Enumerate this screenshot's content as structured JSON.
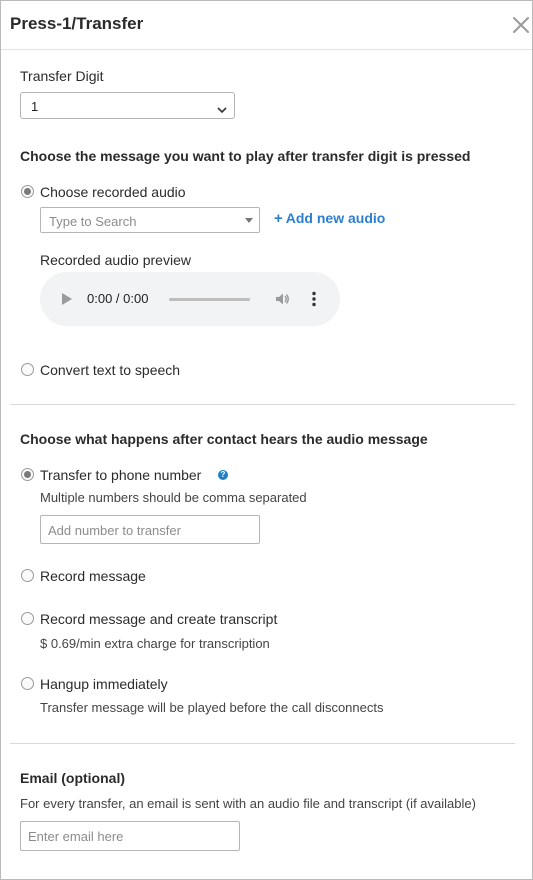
{
  "header": {
    "title": "Press-1/Transfer",
    "close_icon": "close-icon"
  },
  "transfer_digit": {
    "label": "Transfer Digit",
    "selected": "1"
  },
  "message_section": {
    "title": "Choose the message you want to play after transfer digit is pressed",
    "options": {
      "recorded": "Choose recorded audio",
      "tts": "Convert text to speech"
    },
    "search_placeholder": "Type to Search",
    "add_audio": "Add new audio",
    "preview_label": "Recorded audio preview",
    "player_time": "0:00 / 0:00"
  },
  "action_section": {
    "title": "Choose what happens after contact hears the audio message",
    "transfer": {
      "label": "Transfer to phone number",
      "help_glyph": "?",
      "hint": "Multiple numbers should be comma separated",
      "placeholder": "Add number to transfer"
    },
    "record": {
      "label": "Record message"
    },
    "record_transcript": {
      "label": "Record message and create transcript",
      "hint": "$ 0.69/min extra charge for transcription"
    },
    "hangup": {
      "label": "Hangup immediately",
      "hint": "Transfer message will be played before the call disconnects"
    }
  },
  "email_section": {
    "title": "Email (optional)",
    "hint": "For every transfer, an email is sent with an audio file and transcript (if available)",
    "placeholder": "Enter email here"
  },
  "colors": {
    "link": "#2b7fd1",
    "help_badge": "#1f7fc9"
  }
}
